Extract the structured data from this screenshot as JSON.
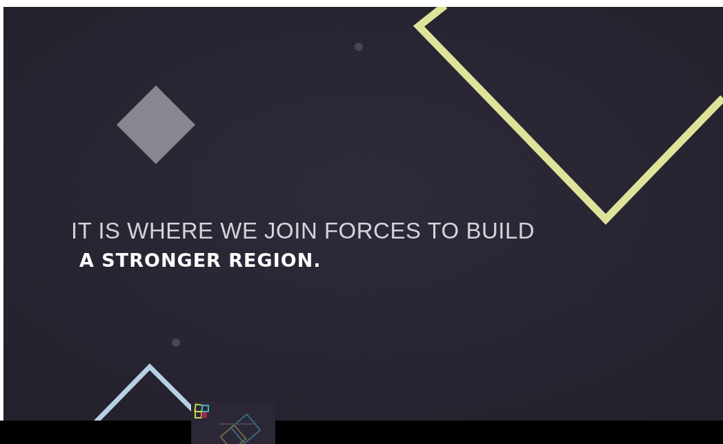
{
  "slide": {
    "lines": [
      {
        "kind": "light",
        "text": "IT IS WHERE WE JOIN FORCES TO BUILD"
      },
      {
        "kind": "bold",
        "text": "A STRONGER REGION."
      }
    ]
  }
}
